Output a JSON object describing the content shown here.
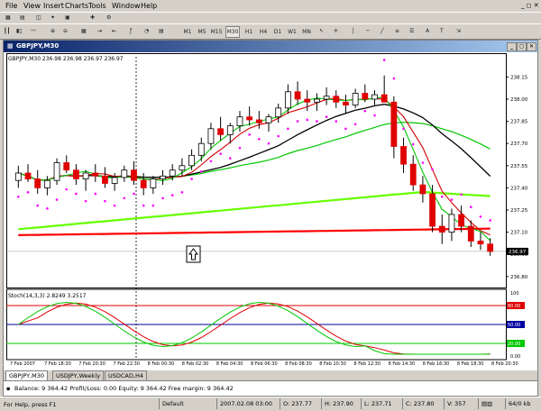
{
  "menu": [
    "File",
    "View",
    "Insert",
    "Charts",
    "Tools",
    "Window",
    "Help"
  ],
  "toolbar": {
    "timeframes": [
      "M1",
      "M5",
      "M15",
      "M30",
      "H1",
      "H4",
      "D1",
      "W1",
      "MN"
    ],
    "active_timeframe": "M30"
  },
  "chart_window": {
    "title": "GBPJPY,M30",
    "info": "GBPJPY,M30  236.98 236.98 236.97 236.97",
    "stoch_label": "Stoch(14,3,3) 2.8249 3.2517"
  },
  "chart_data": {
    "type": "candlestick",
    "symbol": "GBPJPY",
    "timeframe": "M30",
    "price_axis": {
      "ticks": [
        "238.15",
        "238.00",
        "237.85",
        "237.70",
        "237.55",
        "237.40",
        "237.25",
        "237.10",
        "236.95",
        "236.80"
      ],
      "range": [
        236.75,
        238.25
      ],
      "current_price": "236.97"
    },
    "time_labels": [
      "7 Feb 2007",
      "7 Feb 18:30",
      "7 Feb 20:30",
      "7 Feb 22:30",
      "8 Feb 00:30",
      "8 Feb 02:30",
      "8 Feb 04:30",
      "8 Feb 06:30",
      "8 Feb 08:30",
      "8 Feb 10:30",
      "8 Feb 12:30",
      "8 Feb 14:30",
      "8 Feb 16:30",
      "8 Feb 18:30",
      "8 Feb 20:30"
    ],
    "candles": [
      [
        237.45,
        237.55,
        237.4,
        237.5
      ],
      [
        237.5,
        237.56,
        237.44,
        237.46
      ],
      [
        237.46,
        237.52,
        237.36,
        237.4
      ],
      [
        237.4,
        237.48,
        237.35,
        237.45
      ],
      [
        237.45,
        237.6,
        237.42,
        237.57
      ],
      [
        237.57,
        237.62,
        237.5,
        237.52
      ],
      [
        237.52,
        237.56,
        237.42,
        237.46
      ],
      [
        237.46,
        237.52,
        237.38,
        237.5
      ],
      [
        237.5,
        237.56,
        237.44,
        237.48
      ],
      [
        237.48,
        237.54,
        237.4,
        237.43
      ],
      [
        237.43,
        237.5,
        237.38,
        237.47
      ],
      [
        237.47,
        237.55,
        237.44,
        237.52
      ],
      [
        237.52,
        237.58,
        237.42,
        237.45
      ],
      [
        237.45,
        237.5,
        237.35,
        237.4
      ],
      [
        237.4,
        237.48,
        237.36,
        237.46
      ],
      [
        237.46,
        237.52,
        237.42,
        237.48
      ],
      [
        237.48,
        237.56,
        237.45,
        237.52
      ],
      [
        237.52,
        237.6,
        237.48,
        237.55
      ],
      [
        237.55,
        237.66,
        237.52,
        237.62
      ],
      [
        237.62,
        237.74,
        237.58,
        237.7
      ],
      [
        237.7,
        237.84,
        237.66,
        237.8
      ],
      [
        237.8,
        237.88,
        237.72,
        237.76
      ],
      [
        237.76,
        237.84,
        237.7,
        237.82
      ],
      [
        237.82,
        237.92,
        237.78,
        237.88
      ],
      [
        237.88,
        237.95,
        237.82,
        237.86
      ],
      [
        237.86,
        237.92,
        237.8,
        237.84
      ],
      [
        237.84,
        237.9,
        237.78,
        237.88
      ],
      [
        237.88,
        237.97,
        237.84,
        237.94
      ],
      [
        237.94,
        238.1,
        237.9,
        238.05
      ],
      [
        238.05,
        238.12,
        237.96,
        238.0
      ],
      [
        238.0,
        238.06,
        237.92,
        237.98
      ],
      [
        237.98,
        238.04,
        237.92,
        238.0
      ],
      [
        238.0,
        238.08,
        237.96,
        238.02
      ],
      [
        238.02,
        238.06,
        237.94,
        237.98
      ],
      [
        237.98,
        238.03,
        237.9,
        237.96
      ],
      [
        237.96,
        238.07,
        237.94,
        238.04
      ],
      [
        238.04,
        238.1,
        237.98,
        238.0
      ],
      [
        238.0,
        238.06,
        237.96,
        238.03
      ],
      [
        238.03,
        238.16,
        237.98,
        237.98
      ],
      [
        237.98,
        238.02,
        237.6,
        237.68
      ],
      [
        237.68,
        237.74,
        237.5,
        237.56
      ],
      [
        237.56,
        237.62,
        237.38,
        237.42
      ],
      [
        237.42,
        237.48,
        237.3,
        237.36
      ],
      [
        237.36,
        237.42,
        237.1,
        237.14
      ],
      [
        237.14,
        237.22,
        237.02,
        237.1
      ],
      [
        237.1,
        237.26,
        237.04,
        237.22
      ],
      [
        237.22,
        237.28,
        237.1,
        237.14
      ],
      [
        237.14,
        237.18,
        237.0,
        237.04
      ],
      [
        237.04,
        237.1,
        236.98,
        237.02
      ],
      [
        237.02,
        237.06,
        236.94,
        236.97
      ]
    ],
    "stochastic": {
      "name": "Stoch(14,3,3)",
      "main": 2.8249,
      "signal": 3.2517,
      "levels": [
        80,
        50,
        20
      ],
      "axis_ticks": [
        "100",
        "80.00",
        "50.00",
        "20.00",
        "0.00"
      ],
      "range": [
        0,
        100
      ]
    },
    "colors": {
      "bull": "#ffffff",
      "bear": "#e00000",
      "wick": "#000000",
      "sar": "#ff00ff",
      "ma_black": "#000000",
      "ma_green": "#00c800",
      "ma_lightgreen": "#66ff00",
      "ma_red": "#d00000",
      "ma_darkred": "#ff0000",
      "stoch_main": "#00c800",
      "stoch_signal": "#e00000"
    }
  },
  "tabs": [
    "GBPJPY,M30",
    "USDJPY,Weekly",
    "USDCAD,H4"
  ],
  "terminal": {
    "balance_text": "Balance: 9 364.42  Profit/Loss: 0.00  Equity: 9 364.42  Free margin: 9 364.42"
  },
  "status": {
    "help": "For Help, press F1",
    "profile": "Default",
    "datetime": "2007.02.08 03:00",
    "open": "O: 237.77",
    "high": "H: 237.90",
    "low": "L: 237.71",
    "close": "C: 237.80",
    "volume": "V: 357",
    "traffic": "64/0 kb"
  }
}
